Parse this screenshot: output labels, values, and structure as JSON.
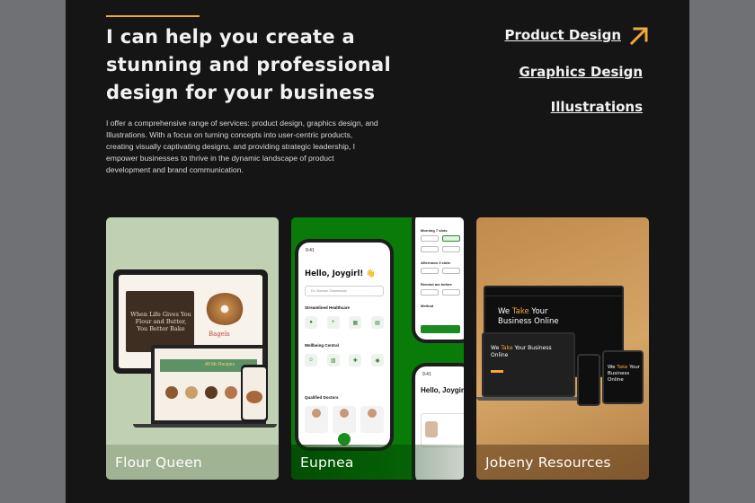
{
  "headline": "I can help you create a stunning and professional design for your business",
  "intro": "I offer a comprehensive range of services: product design, graphics design, and Illustrations. With a focus on turning concepts into user-centric products, creating visually captivating designs, and providing strategic leadership, I empower businesses to thrive in the dynamic landscape of product development and brand communication.",
  "nav": {
    "primary": "Product Design",
    "secondary": "Graphics Design",
    "tertiary": "Illustrations",
    "arrow_icon": "arrow-up-right-icon"
  },
  "projects": [
    {
      "label": "Flour Queen",
      "mock": {
        "hero_text": "When Life Gives You Flour and Butter, You Better Bake",
        "item_title": "Bagels",
        "banner_text": "All Mc Recipes"
      }
    },
    {
      "label": "Eupnea",
      "mock": {
        "time": "9:41",
        "greeting": "Hello, Joygirl! 👋",
        "search_placeholder": "Dr. Noreen Gbemisola",
        "section1": "Streamlined Healthcare",
        "section2": "Wellbeing Central",
        "section3": "Qualified Doctors",
        "morning": "Morning 7 slots",
        "afternoon": "Afternoon 3 slots",
        "remind": "Remind me before",
        "method": "Method",
        "greeting2": "Hello, Joygir"
      }
    },
    {
      "label": "Jobeny Resources",
      "mock": {
        "we": "We",
        "take": "Take",
        "rest": "Your Business Online"
      }
    }
  ],
  "colors": {
    "accent": "#f0a83a",
    "background": "#151515",
    "eupnea_green": "#087b09"
  }
}
